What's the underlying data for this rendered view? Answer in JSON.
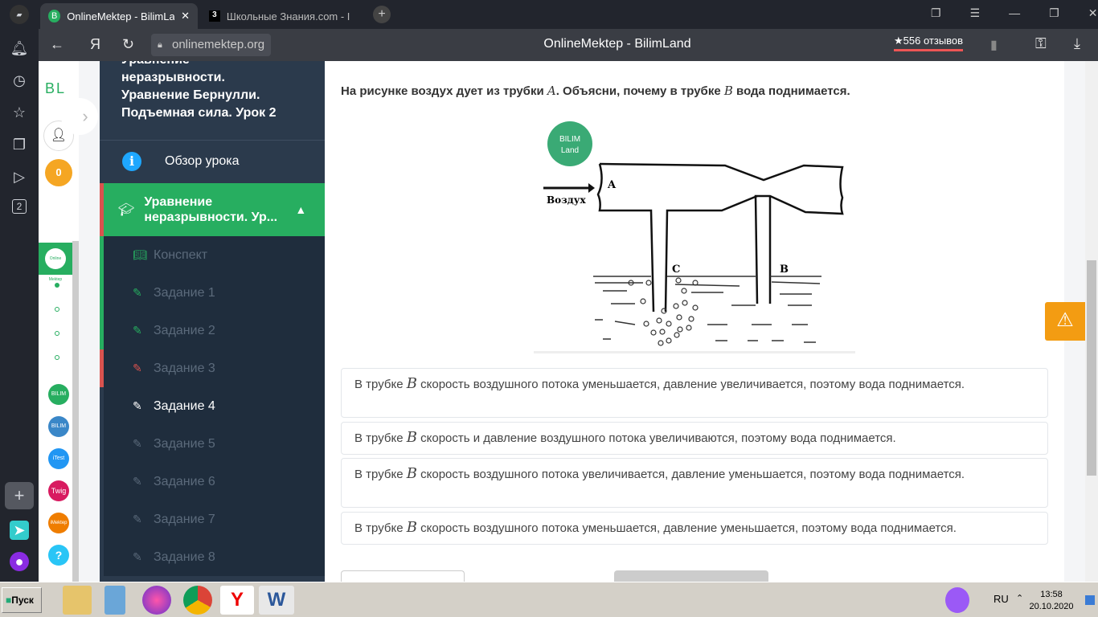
{
  "browser": {
    "tabs": [
      {
        "label": "OnlineMektep - BilimLan",
        "favicon": "B"
      },
      {
        "label": "Школьные Знания.com - I",
        "favicon": "3"
      }
    ],
    "url": "onlinemektep.org",
    "page_title": "OnlineMektep - BilimLand",
    "reviews": "★556 отзывов",
    "side_badge": "2"
  },
  "app": {
    "logo": "BL",
    "score": "0",
    "apps": [
      "BILIM Land",
      "BILIM Book",
      "iTest",
      "Twig",
      "iMektep",
      "?"
    ],
    "current_app": "Online Mektep"
  },
  "lesson": {
    "title_lines": [
      "Уравнение",
      "неразрывности.",
      "Уравнение Бернулли.",
      "Подъемная сила. Урок 2"
    ],
    "overview": "Обзор урока",
    "section": "Уравнение неразрывности. Ур...",
    "items": [
      "Конспект",
      "Задание 1",
      "Задание 2",
      "Задание 3",
      "Задание 4",
      "Задание 5",
      "Задание 6",
      "Задание 7",
      "Задание 8"
    ]
  },
  "task": {
    "question_pre": "На рисунке воздух дует из трубки ",
    "var_a": "A",
    "question_mid": ". Объясни, почему в трубке ",
    "var_b": "B",
    "question_post": " вода поднимается.",
    "figure": {
      "logo": [
        "BILIM",
        "Land"
      ],
      "label_air": "Воздух",
      "label_a": "A",
      "label_b": "B",
      "label_c": "C"
    },
    "options": [
      {
        "pre": "В трубке ",
        "var": "B",
        "post": " скорость воздушного потока уменьшается, давление увеличивается, поэтому вода поднимается."
      },
      {
        "pre": "В трубке ",
        "var": "B",
        "post": " скорость и давление воздушного потока увеличиваются, поэтому вода поднимается."
      },
      {
        "pre": "В трубке ",
        "var": "B",
        "post": " скорость воздушного потока увеличивается, давление уменьшается, поэтому вода поднимается."
      },
      {
        "pre": "В трубке ",
        "var": "B",
        "post": " скорость воздушного потока уменьшается, давление уменьшается, поэтому вода поднимается."
      }
    ]
  },
  "taskbar": {
    "start": "Пуск",
    "lang": "RU",
    "time": "13:58",
    "date": "20.10.2020"
  },
  "colors": {
    "green": "#27ae60",
    "navy": "#2b3a4c",
    "orange": "#f39c12"
  }
}
